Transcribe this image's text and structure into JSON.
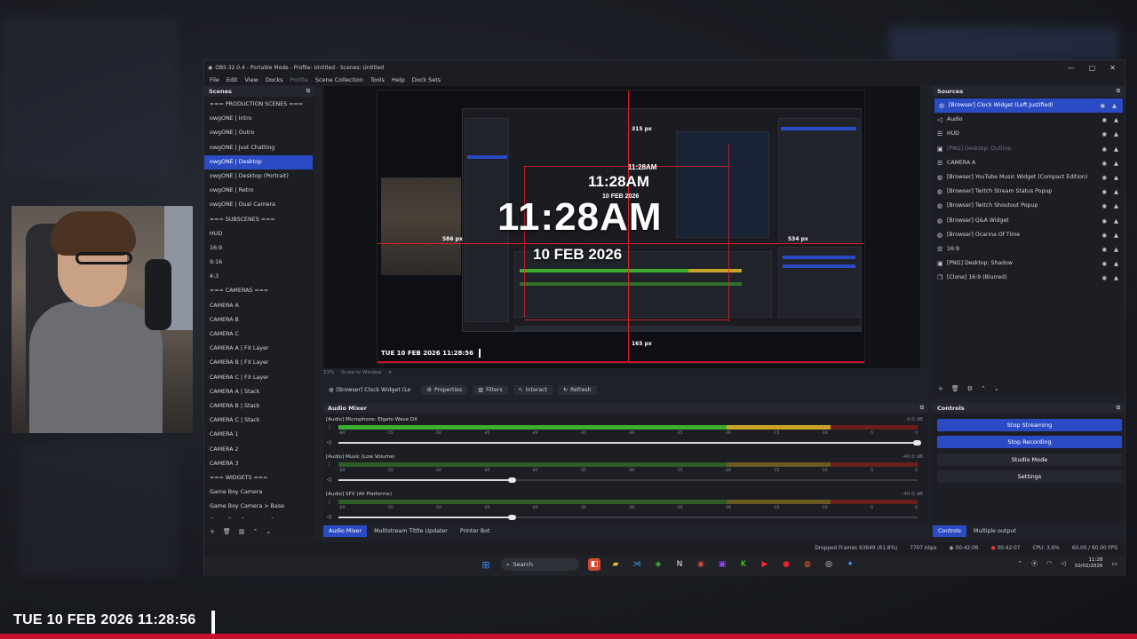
{
  "window": {
    "title": "OBS 32.0.4 - Portable Mode - Profile: Untitled - Scenes: Untitled",
    "controls": [
      "—",
      "▢",
      "✕"
    ]
  },
  "menu": [
    "File",
    "Edit",
    "View",
    "Docks",
    "Profile",
    "Scene Collection",
    "Tools",
    "Help",
    "Dock Sets"
  ],
  "scenes": {
    "title": "Scenes",
    "items": [
      "=== PRODUCTION SCENES ===",
      "owgONE | Intro",
      "owgONE | Outro",
      "owgONE | Just Chatting",
      "owgONE | Desktop",
      "owgONE | Desktop (Portrait)",
      "owgONE | Retro",
      "owgONE | Dual Camera",
      "=== SUBSCENES ===",
      "HUD",
      "16:9",
      "9:16",
      "4:3",
      "=== CAMERAS ===",
      "CAMERA A",
      "CAMERA B",
      "CAMERA C",
      "CAMERA A | FX Layer",
      "CAMERA B | FX Layer",
      "CAMERA C | FX Layer",
      "CAMERA A | Stack",
      "CAMERA B | Stack",
      "CAMERA C | Stack",
      "CAMERA 1",
      "CAMERA 2",
      "CAMERA 3",
      "=== WIDGETS ===",
      "Game Boy Camera",
      "Game Boy Camera > Base",
      "Game Boy Camera > Screen"
    ],
    "active_index": 4
  },
  "preview": {
    "big_time": "11:28AM",
    "big_date": "10 FEB 2026",
    "mid_time": "11:28AM",
    "mid_date": "10 FEB 2026",
    "small_time": "11:28AM",
    "px_top": "315 px",
    "px_left": "586 px",
    "px_right": "534 px",
    "px_bottom": "165 px",
    "ticker": "TUE 10 FEB 2026 11:28:56",
    "zoom": "53%",
    "scale_mode": "Scale to Window"
  },
  "source_toolbar": {
    "selected": "[Browser] Clock Widget (Le",
    "properties": "Properties",
    "filters": "Filters",
    "interact": "Interact",
    "refresh": "Refresh"
  },
  "mixer": {
    "title": "Audio Mixer",
    "channels": [
      {
        "name": "[Audio] Microphone: Elgato Wave DX",
        "db": "0.0 dB",
        "level": 0.57,
        "slider": 1.0
      },
      {
        "name": "[Audio] Music (Low Volume)",
        "db": "-40.0 dB",
        "level": 0.0,
        "slider": 0.3
      },
      {
        "name": "[Audio] SFX (All Platforms)",
        "db": "-40.0 dB",
        "level": 0.0,
        "slider": 0.3
      }
    ],
    "scale": [
      "-60",
      "-55",
      "-50",
      "-45",
      "-40",
      "-35",
      "-30",
      "-25",
      "-20",
      "-15",
      "-10",
      "-5",
      "0"
    ]
  },
  "dock_tabs": [
    "Audio Mixer",
    "Multistream Tittle Updater",
    "Printer Bot"
  ],
  "sources": {
    "title": "Sources",
    "items": [
      {
        "label": "[Browser] Clock Widget (Left Justified)",
        "icon": "globe-icon",
        "active": true,
        "dim": false
      },
      {
        "label": "Audio",
        "icon": "speaker-icon",
        "active": false,
        "dim": false
      },
      {
        "label": "HUD",
        "icon": "list-icon",
        "active": false,
        "dim": false
      },
      {
        "label": "[PNG] Desktop: Outline",
        "icon": "image-icon",
        "active": false,
        "dim": true
      },
      {
        "label": "CAMERA A",
        "icon": "list-icon",
        "active": false,
        "dim": false
      },
      {
        "label": "[Browser] YouTube Music Widget (Compact Edition)",
        "icon": "globe-icon",
        "active": false,
        "dim": false
      },
      {
        "label": "[Browser] Twitch Stream Status Popup",
        "icon": "globe-icon",
        "active": false,
        "dim": false
      },
      {
        "label": "[Browser] Twitch Shoutout Popup",
        "icon": "globe-icon",
        "active": false,
        "dim": false
      },
      {
        "label": "[Browser] Q&A Widget",
        "icon": "globe-icon",
        "active": false,
        "dim": false
      },
      {
        "label": "[Browser] Ocarina Of Time",
        "icon": "globe-icon",
        "active": false,
        "dim": false
      },
      {
        "label": "16:9",
        "icon": "list-icon",
        "active": false,
        "dim": false
      },
      {
        "label": "[PNG] Desktop: Shadow",
        "icon": "image-icon",
        "active": false,
        "dim": false
      },
      {
        "label": "[Clone] 16:9 (Blurred)",
        "icon": "clone-icon",
        "active": false,
        "dim": false
      }
    ]
  },
  "controls": {
    "title": "Controls",
    "stop_streaming": "Stop Streaming",
    "stop_recording": "Stop Recording",
    "studio_mode": "Studio Mode",
    "settings": "Settings"
  },
  "right_tabs": [
    "Controls",
    "Multiple output"
  ],
  "status": {
    "dropped": "Dropped Frames 93649 (61.8%)",
    "bitrate": "7707 kbps",
    "stream_time": "00:42:06",
    "rec_time": "00:42:07",
    "cpu": "CPU: 3.6%",
    "fps": "60.00 / 60.00 FPS"
  },
  "taskbar": {
    "search": "Search",
    "time": "11:28",
    "date": "10/02/2026"
  },
  "overlay": {
    "text": "TUE 10 FEB 2026 11:28:56"
  },
  "colors": {
    "accent": "#2a4bc4",
    "record_red": "#c8102e",
    "meter_green": "#3fae2f",
    "meter_yellow": "#c9a227",
    "meter_red": "#b3261e"
  }
}
